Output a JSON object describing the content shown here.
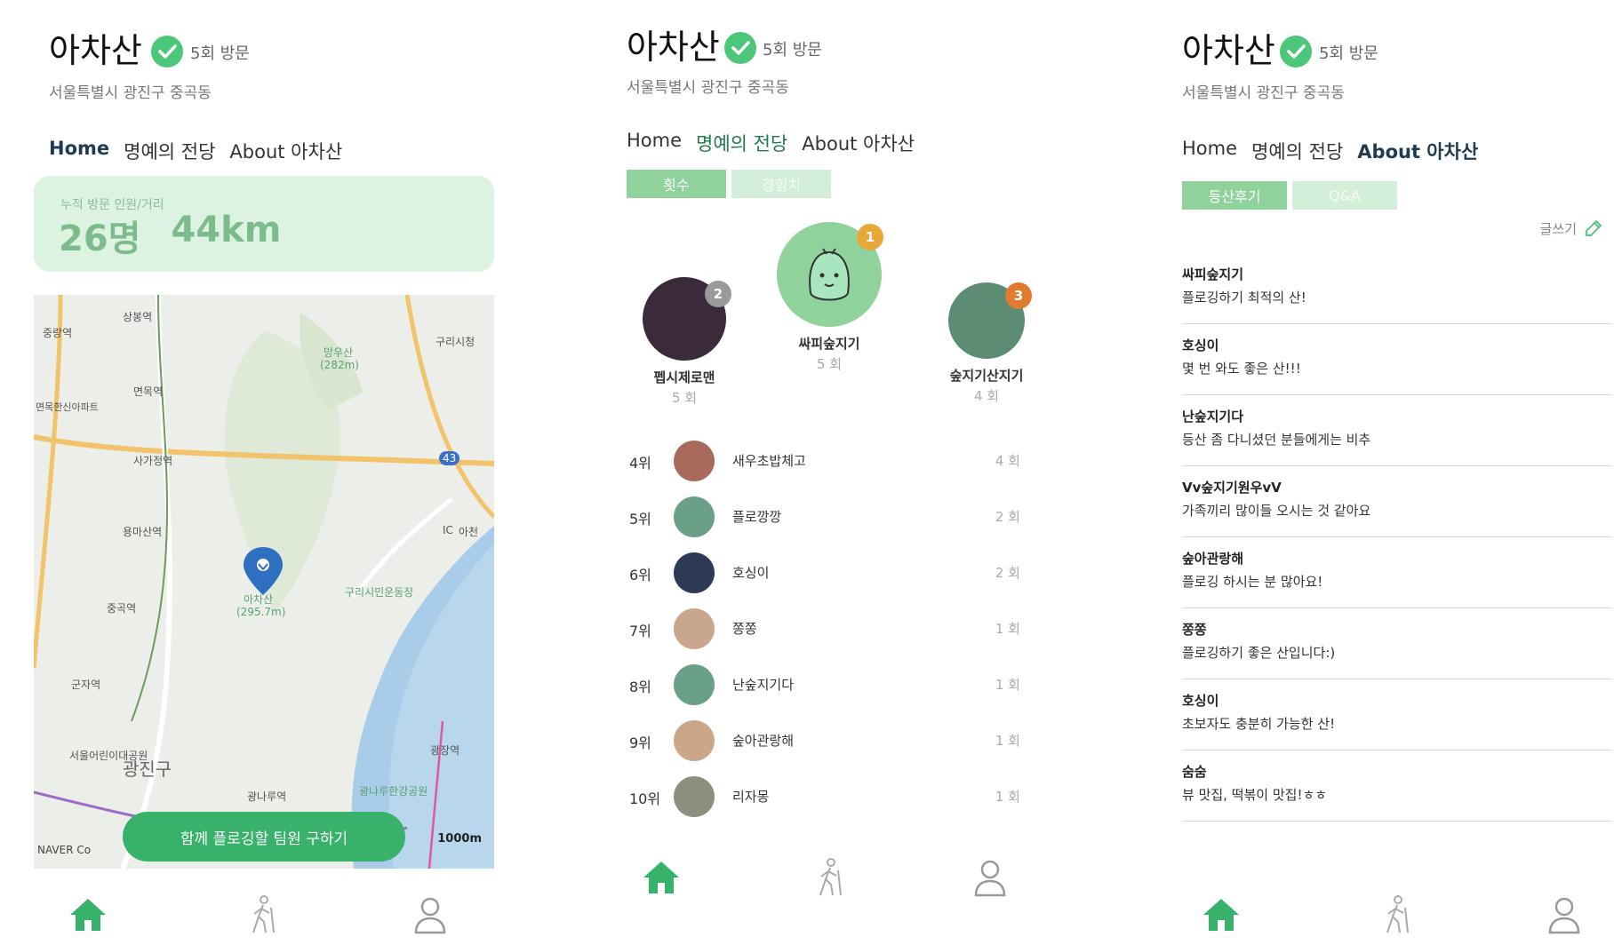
{
  "app": {
    "title": "아차산",
    "visits": "5회 방문",
    "address": "서울특별시 광진구 중곡동",
    "tabs": [
      "Home",
      "명예의 전당",
      "About 아차산"
    ]
  },
  "colors": {
    "accent": "#38b26b",
    "accent_light": "#dcf3e2",
    "check": "#4cc77a",
    "active_tab": "#1f3b52"
  },
  "home": {
    "stats_label": "누적 방문 인원/거리",
    "people": "26명",
    "distance": "44km",
    "map_labels": [
      "중랑역",
      "상봉역",
      "면목역",
      "망우산",
      "(282m)",
      "구리시청",
      "면목한신아파트",
      "사가정역",
      "용마산역",
      "중곡역",
      "아차산",
      "(295.7m)",
      "구리시민운동장",
      "군자역",
      "서울어린이대공원",
      "광진구",
      "광나루역",
      "광나루한강공원",
      "광장역",
      "아천",
      "43",
      "IC"
    ],
    "map_footer": "NAVER Co",
    "scale": "1000m",
    "team_button": "함께 플로깅할 팀원 구하기"
  },
  "hall": {
    "segments": [
      "횟수",
      "경험치"
    ],
    "podium": [
      {
        "rank": "1",
        "name": "싸피숲지기",
        "count": "5 회",
        "color": "#e8a838",
        "bg": "#8fd29c"
      },
      {
        "rank": "2",
        "name": "펩시제로맨",
        "count": "5 회",
        "color": "#9a9a9a",
        "bg": "#3a2a3a"
      },
      {
        "rank": "3",
        "name": "숲지기산지기",
        "count": "4 회",
        "color": "#e07a2e",
        "bg": "#5c8c74"
      }
    ],
    "ranks": [
      {
        "no": "4위",
        "name": "새우초밥체고",
        "count": "4 회",
        "bg": "#a86a5a"
      },
      {
        "no": "5위",
        "name": "플로깡깡",
        "count": "2 회",
        "bg": "#6aa088"
      },
      {
        "no": "6위",
        "name": "호싱이",
        "count": "2 회",
        "bg": "#2d3a55"
      },
      {
        "no": "7위",
        "name": "쫑쫑",
        "count": "1 회",
        "bg": "#c9a68e"
      },
      {
        "no": "8위",
        "name": "난숲지기다",
        "count": "1 회",
        "bg": "#6aa088"
      },
      {
        "no": "9위",
        "name": "숲아관랑해",
        "count": "1 회",
        "bg": "#caa68a"
      },
      {
        "no": "10위",
        "name": "리자몽",
        "count": "1 회",
        "bg": "#8e8e7e"
      }
    ]
  },
  "about": {
    "segments": [
      "등산후기",
      "Q&A"
    ],
    "write_label": "글쓰기",
    "reviews": [
      {
        "author": "싸피숲지기",
        "text": "플로깅하기 최적의 산!"
      },
      {
        "author": "호싱이",
        "text": "몇 번 와도 좋은 산!!!"
      },
      {
        "author": "난숲지기다",
        "text": "등산 좀 다니셨던 분들에게는 비추"
      },
      {
        "author": "Vv숲지기원우vV",
        "text": "가족끼리 많이들 오시는 것 같아요"
      },
      {
        "author": "숲아관랑해",
        "text": "플로깅 하시는 분 많아요!"
      },
      {
        "author": "쫑쫑",
        "text": "플로깅하기 좋은 산입니다:)"
      },
      {
        "author": "호싱이",
        "text": "초보자도 충분히 가능한 산!"
      },
      {
        "author": "숨숨",
        "text": "뷰 맛집, 떡볶이 맛집!ㅎㅎ"
      }
    ]
  },
  "icons": {
    "home": "home-icon",
    "hiking": "hiking-icon",
    "profile": "profile-icon"
  }
}
